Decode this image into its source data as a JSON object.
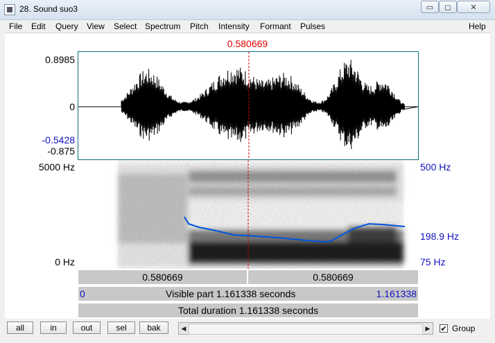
{
  "window": {
    "title": "28. Sound suo3",
    "controls": {
      "minimize": "▭",
      "maximize": "◻",
      "close": "✕"
    }
  },
  "menu": [
    "File",
    "Edit",
    "Query",
    "View",
    "Select",
    "Spectrum",
    "Pitch",
    "Intensity",
    "Formant",
    "Pulses",
    "Help"
  ],
  "cursor": {
    "time": "0.580669"
  },
  "waveform": {
    "y_max": "0.8985",
    "y_zero": "0",
    "y_cursor": "-0.5428",
    "y_min": "-0.875"
  },
  "spectrogram": {
    "freq_top": "5000 Hz",
    "freq_bottom": "0 Hz",
    "pitch_top": "500 Hz",
    "pitch_value": "198.9 Hz",
    "pitch_bottom": "75 Hz"
  },
  "selection": {
    "left": "0.580669",
    "right": "0.580669"
  },
  "visible": {
    "start": "0",
    "label": "Visible part 1.161338 seconds",
    "end": "1.161338"
  },
  "total": {
    "label": "Total duration 1.161338 seconds"
  },
  "buttons": {
    "all": "all",
    "in": "in",
    "out": "out",
    "sel": "sel",
    "bak": "bak"
  },
  "group": {
    "label": "Group",
    "checked": true
  },
  "colors": {
    "cursor": "#e00000",
    "pitch": "#0055dd",
    "axis_blue": "#1010c0"
  }
}
